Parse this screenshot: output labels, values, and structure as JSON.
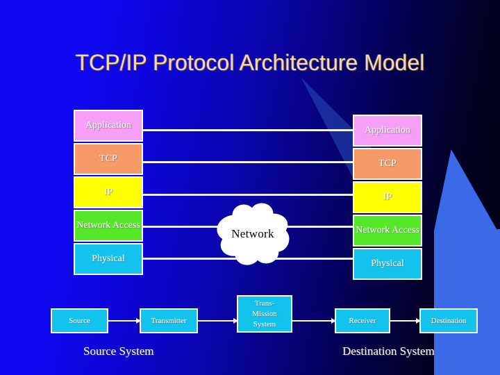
{
  "slide": {
    "title": "TCP/IP Protocol Architecture Model",
    "background_left_color": "#1008f2",
    "background_right_color": "#01010e",
    "title_color": "#f7d9ad"
  },
  "stacks": {
    "left": {
      "name": "Source System protocol stack",
      "layers": [
        {
          "label": "Application",
          "color": "#f79ff7"
        },
        {
          "label": "TCP",
          "color": "#f89a68"
        },
        {
          "label": "IP",
          "color": "#ffff00"
        },
        {
          "label": "Network Access",
          "color": "#55e829"
        },
        {
          "label": "Physical",
          "color": "#12c3ee"
        }
      ]
    },
    "right": {
      "name": "Destination System protocol stack",
      "layers": [
        {
          "label": "Application",
          "color": "#f79ff7"
        },
        {
          "label": "TCP",
          "color": "#f89a68"
        },
        {
          "label": "IP",
          "color": "#ffff00"
        },
        {
          "label": "Network Access",
          "color": "#55e829"
        },
        {
          "label": "Physical",
          "color": "#12c3ee"
        }
      ]
    }
  },
  "cloud": {
    "label": "Network",
    "fill_color": "#ffffff",
    "text_color": "#000000"
  },
  "flow": {
    "boxes": [
      {
        "label": "Source",
        "color": "#12c3ee"
      },
      {
        "label": "Transmitter",
        "color": "#12c3ee"
      },
      {
        "label": "Trans-\nMission\nSystem",
        "color": "#12c3ee"
      },
      {
        "label": "Receiver",
        "color": "#12c3ee"
      },
      {
        "label": "Destination",
        "color": "#12c3ee"
      }
    ],
    "transmission_lines": [
      "Trans-",
      "Mission",
      "System"
    ]
  },
  "captions": {
    "source": "Source System",
    "destination": "Destination System"
  }
}
